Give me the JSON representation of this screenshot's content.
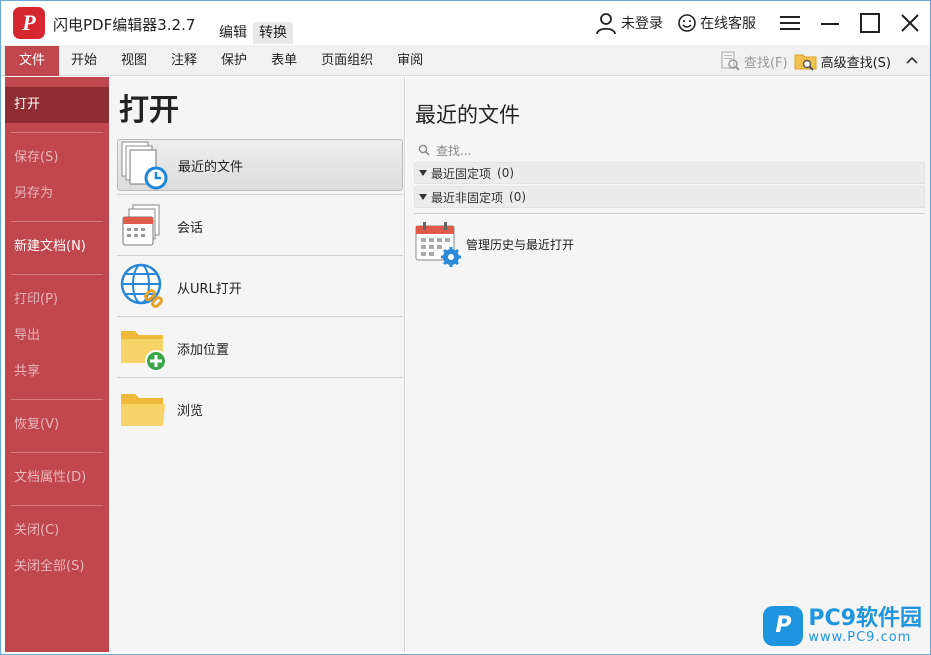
{
  "app": {
    "title": "闪电PDF编辑器3.2.7",
    "logo_letter": "P",
    "quick_tabs": [
      "编辑",
      "转换"
    ]
  },
  "titlebar": {
    "login_label": "未登录",
    "service_label": "在线客服"
  },
  "ribbon": {
    "tabs": [
      "文件",
      "开始",
      "视图",
      "注释",
      "保护",
      "表单",
      "页面组织",
      "审阅"
    ],
    "find_label": "查找(F)",
    "advanced_find_label": "高级查找(S)"
  },
  "backstage": {
    "items": [
      "打开",
      "保存(S)",
      "另存为",
      "新建文档(N)",
      "打印(P)",
      "导出",
      "共享",
      "恢复(V)",
      "文档属性(D)",
      "关闭(C)",
      "关闭全部(S)"
    ]
  },
  "open_panel": {
    "heading": "打开",
    "items": [
      "最近的文件",
      "会话",
      "从URL打开",
      "添加位置",
      "浏览"
    ]
  },
  "recent_panel": {
    "heading": "最近的文件",
    "search_placeholder": "查找...",
    "pinned_label": "最近固定项",
    "pinned_count": "(0)",
    "unpinned_label": "最近非固定项",
    "unpinned_count": "(0)",
    "manage_label": "管理历史与最近打开"
  },
  "watermark": {
    "logo_letter": "P",
    "main": "PC9软件园",
    "sub": "www.PC9.com"
  },
  "colors": {
    "accent_red": "#c0474d",
    "accent_dark_red": "#8e2c31",
    "logo_red": "#d6262f",
    "watermark_blue": "#1f95e0"
  }
}
